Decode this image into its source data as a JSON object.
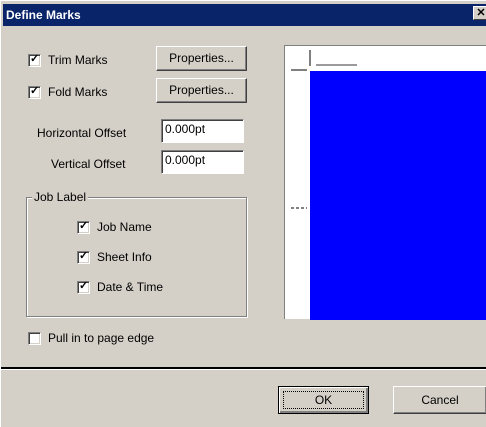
{
  "window": {
    "title": "Define Marks",
    "close_glyph": "✕"
  },
  "options": {
    "trim_marks": {
      "label": "Trim Marks",
      "checked": true,
      "properties_label": "Properties..."
    },
    "fold_marks": {
      "label": "Fold Marks",
      "checked": true,
      "properties_label": "Properties..."
    },
    "horizontal_offset": {
      "label": "Horizontal Offset",
      "value": "0.000pt"
    },
    "vertical_offset": {
      "label": "Vertical Offset",
      "value": "0.000pt"
    }
  },
  "job_label": {
    "title": "Job Label",
    "items": [
      {
        "label": "Job Name",
        "checked": true
      },
      {
        "label": "Sheet Info",
        "checked": true
      },
      {
        "label": "Date & Time",
        "checked": true
      }
    ]
  },
  "pull_in": {
    "label": "Pull in to page edge",
    "checked": false
  },
  "footer": {
    "ok_label": "OK",
    "cancel_label": "Cancel"
  },
  "colors": {
    "titlebar": "#0a246a",
    "preview_page": "#0000ff",
    "dialog_bg": "#d4d0c8"
  },
  "check_glyph": "✓"
}
